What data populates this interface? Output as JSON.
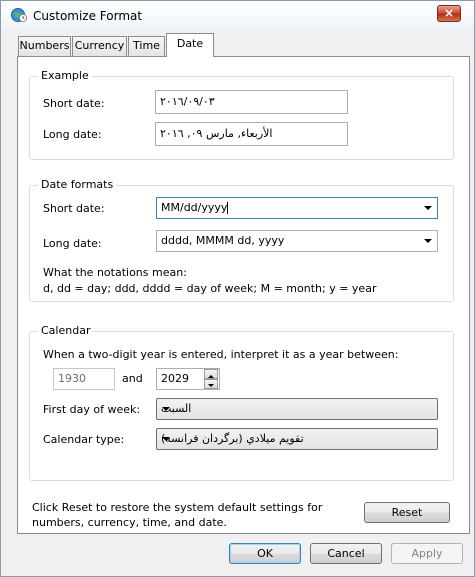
{
  "window": {
    "title": "Customize Format",
    "close_label": "×"
  },
  "tabs": [
    {
      "label": "Numbers",
      "active": false
    },
    {
      "label": "Currency",
      "active": false
    },
    {
      "label": "Time",
      "active": false
    },
    {
      "label": "Date",
      "active": true
    }
  ],
  "example": {
    "legend": "Example",
    "short_label": "Short date:",
    "short_value": "٢٠١٦/٠٩/٠٣",
    "long_label": "Long date:",
    "long_value": "الأربعاء, مارس ٠٩, ٢٠١٦"
  },
  "formats": {
    "legend": "Date formats",
    "short_label": "Short date:",
    "short_value": "MM/dd/yyyy",
    "long_label": "Long date:",
    "long_value": "dddd, MMMM dd, yyyy",
    "notation_title": "What the notations mean:",
    "notation_text": "d, dd = day;  ddd, dddd = day of week;  M = month;  y = year"
  },
  "calendar": {
    "legend": "Calendar",
    "two_digit_text": "When a two-digit year is entered, interpret it as a year between:",
    "year_from": "1930",
    "and_label": "and",
    "year_to": "2029",
    "first_day_label": "First day of week:",
    "first_day_value": "السبت",
    "type_label": "Calendar type:",
    "type_value": "تقويم ميلادي (برگردان فرانسه)"
  },
  "reset": {
    "text_line1": "Click Reset to restore the system default settings for",
    "text_line2": "numbers, currency, time, and date.",
    "button": "Reset"
  },
  "footer": {
    "ok": "OK",
    "cancel": "Cancel",
    "apply": "Apply"
  }
}
